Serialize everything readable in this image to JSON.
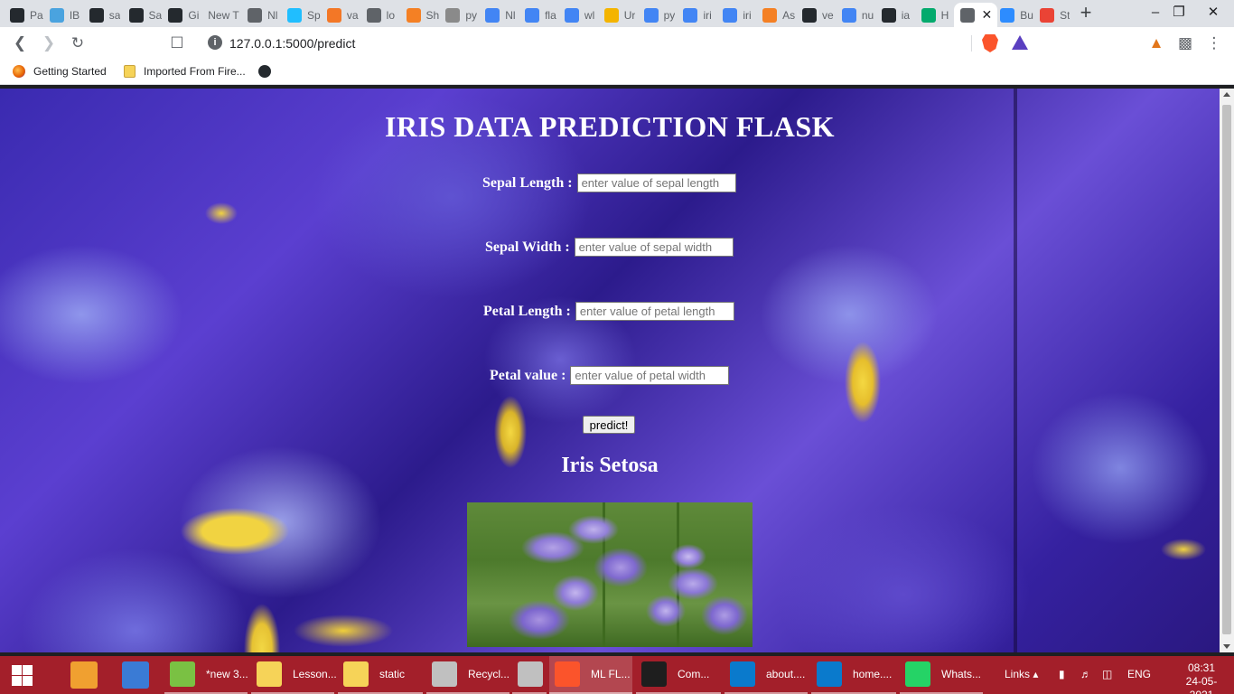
{
  "browser": {
    "tabs": [
      {
        "label": "Pa",
        "icon": "github-icon",
        "color": "#24292e"
      },
      {
        "label": "IB",
        "icon": "cloud-icon",
        "color": "#4aa3df"
      },
      {
        "label": "sa",
        "icon": "github-icon",
        "color": "#24292e"
      },
      {
        "label": "Sa",
        "icon": "github-icon",
        "color": "#24292e"
      },
      {
        "label": "Gi",
        "icon": "github-icon",
        "color": "#24292e"
      },
      {
        "label": "New T",
        "icon": "",
        "color": ""
      },
      {
        "label": "Nl",
        "icon": "globe-icon",
        "color": "#5f6368"
      },
      {
        "label": "Sp",
        "icon": "kaggle-icon",
        "color": "#20beff"
      },
      {
        "label": "va",
        "icon": "jupyter-icon",
        "color": "#f37726"
      },
      {
        "label": "lo",
        "icon": "doc-icon",
        "color": "#5f6368"
      },
      {
        "label": "Sh",
        "icon": "stack-icon",
        "color": "#f48024"
      },
      {
        "label": "py",
        "icon": "python-icon",
        "color": "#8a8a8a"
      },
      {
        "label": "Nl",
        "icon": "google-icon",
        "color": "#4285f4"
      },
      {
        "label": "fla",
        "icon": "flag-icon",
        "color": "#4285f4"
      },
      {
        "label": "wl",
        "icon": "google-icon",
        "color": "#4285f4"
      },
      {
        "label": "Ur",
        "icon": "bookmark-icon",
        "color": "#f4b400"
      },
      {
        "label": "py",
        "icon": "google-icon",
        "color": "#4285f4"
      },
      {
        "label": "iri",
        "icon": "google-icon",
        "color": "#4285f4"
      },
      {
        "label": "iri",
        "icon": "google-icon",
        "color": "#4285f4"
      },
      {
        "label": "As",
        "icon": "stack-icon",
        "color": "#f48024"
      },
      {
        "label": "ve",
        "icon": "github-icon",
        "color": "#24292e"
      },
      {
        "label": "nu",
        "icon": "google-icon",
        "color": "#4285f4"
      },
      {
        "label": "ia",
        "icon": "github-icon",
        "color": "#24292e"
      },
      {
        "label": "H",
        "icon": "w3-icon",
        "color": "#04aa6d"
      },
      {
        "label": "",
        "icon": "globe-icon",
        "color": "#5f6368"
      },
      {
        "label": "Bu",
        "icon": "zoom-icon",
        "color": "#2d8cff"
      },
      {
        "label": "St",
        "icon": "gmail-icon",
        "color": "#ea4335"
      }
    ],
    "address": "127.0.0.1:5000/predict",
    "bookmarks": [
      {
        "label": "Getting Started",
        "icon": "firefox-icon"
      },
      {
        "label": "Imported From Fire...",
        "icon": "folder-icon"
      }
    ]
  },
  "page": {
    "title": "IRIS DATA PREDICTION FLASK",
    "fields": [
      {
        "label": "Sepal Length :",
        "placeholder": "enter value of sepal length"
      },
      {
        "label": "Sepal Width :",
        "placeholder": "enter value of sepal width"
      },
      {
        "label": "Petal Length :",
        "placeholder": "enter value of petal length"
      },
      {
        "label": "Petal value :",
        "placeholder": "enter value of petal width"
      }
    ],
    "submit_label": "predict!",
    "result": "Iris Setosa"
  },
  "taskbar": {
    "items": [
      {
        "label": "*new 3...",
        "icon": "notepadpp-icon",
        "color": "#7ac143"
      },
      {
        "label": "Lesson...",
        "icon": "folder-icon",
        "color": "#f6d358"
      },
      {
        "label": "static",
        "icon": "folder-icon",
        "color": "#f6d358"
      },
      {
        "label": "Recycl...",
        "icon": "recycle-bin-icon",
        "color": "#c0c0c0"
      },
      {
        "label": "",
        "icon": "snipping-tool-icon",
        "color": "#c0c0c0"
      },
      {
        "label": "ML FL...",
        "icon": "brave-icon",
        "color": "#fb542b"
      },
      {
        "label": "Com...",
        "icon": "terminal-icon",
        "color": "#1e1e1e"
      },
      {
        "label": "about....",
        "icon": "vscode-icon",
        "color": "#0a7acc"
      },
      {
        "label": "home....",
        "icon": "vscode-icon",
        "color": "#0a7acc"
      },
      {
        "label": "Whats...",
        "icon": "whatsapp-icon",
        "color": "#25d366"
      }
    ],
    "links_label": "Links",
    "language": "ENG",
    "time": "08:31",
    "date": "24-05-2021"
  },
  "colors": {
    "taskbar": "#a31f2a",
    "heading_text": "#ffffff",
    "background_flower": "#4b35c0"
  }
}
